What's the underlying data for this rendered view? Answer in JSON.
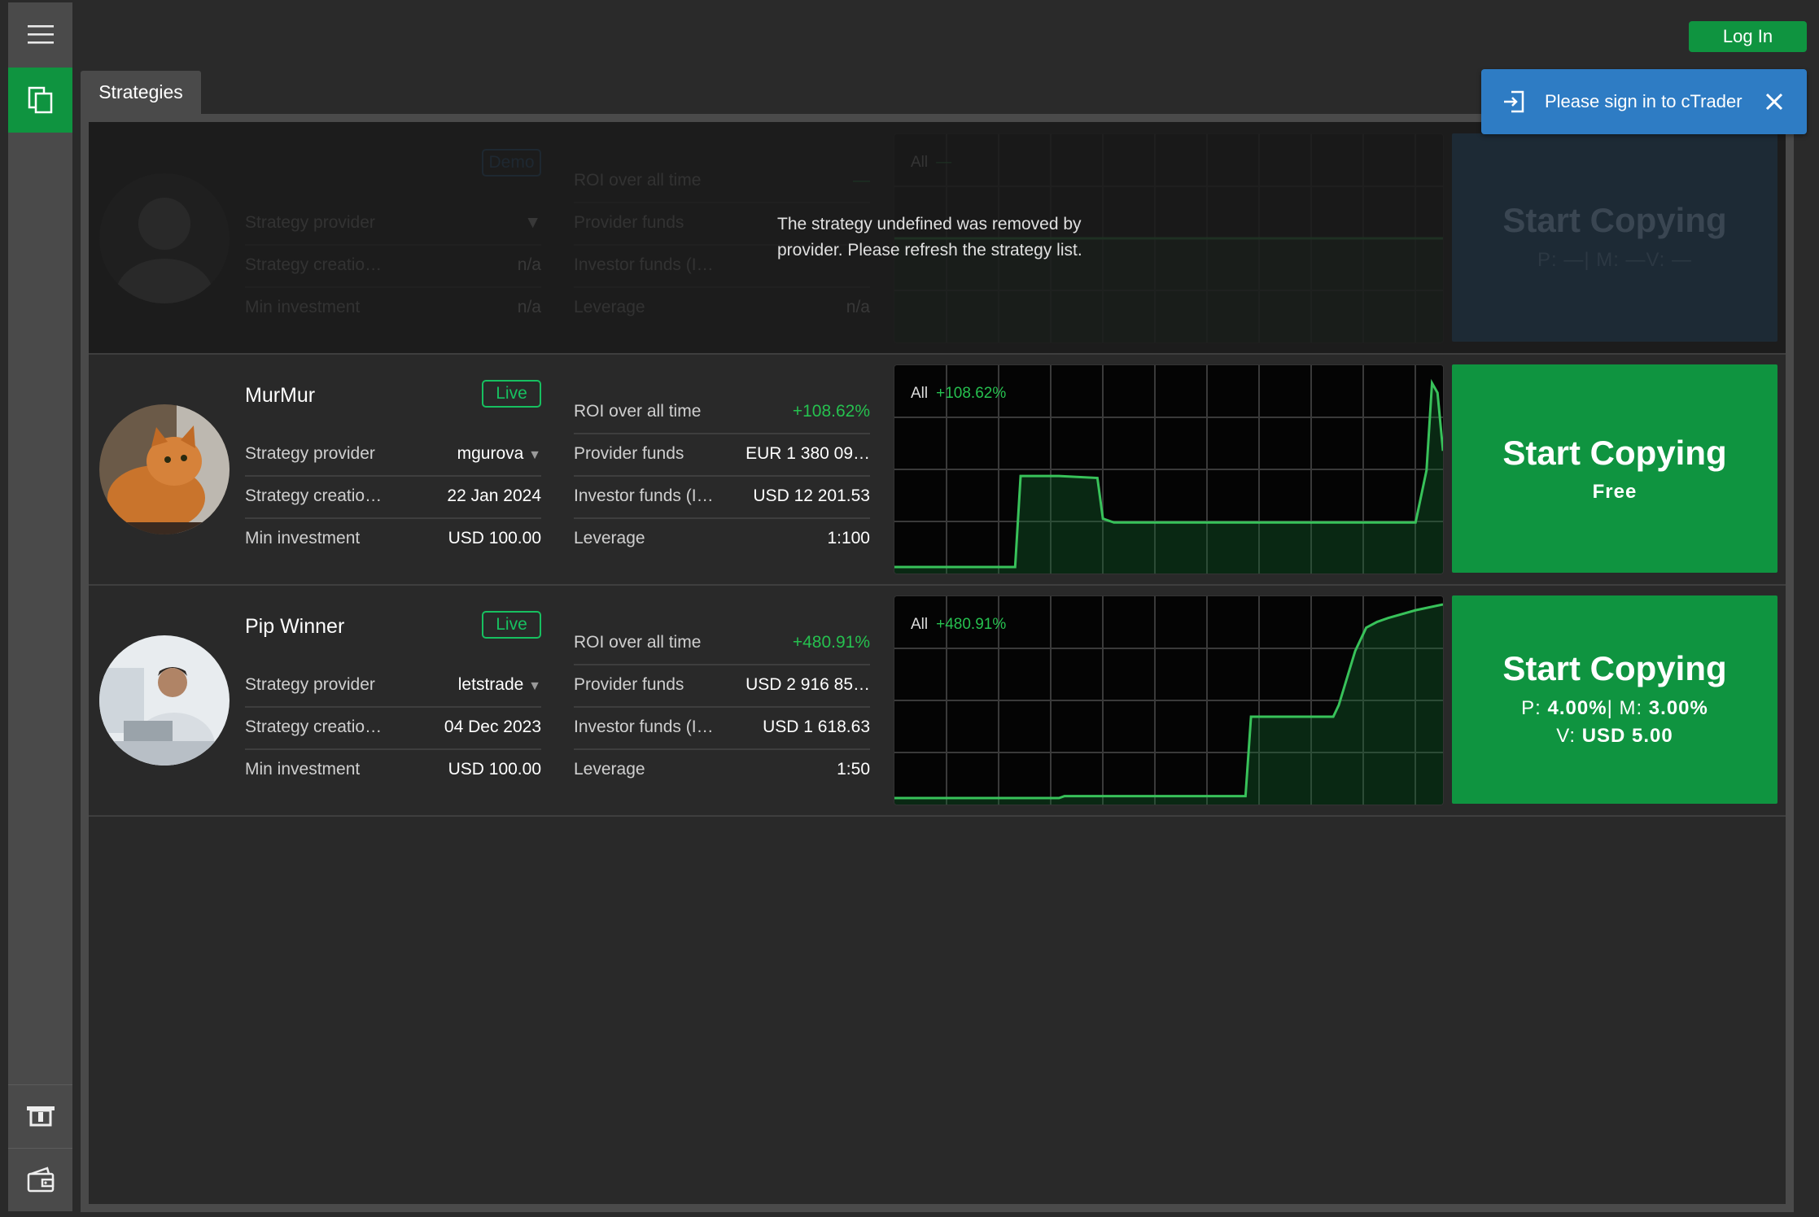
{
  "header": {
    "login_label": "Log In",
    "tab_label": "Strategies"
  },
  "toast": {
    "message": "Please sign in to cTrader",
    "icon": "sign-in-icon",
    "close_icon": "close-icon"
  },
  "sidebar": {
    "items": [
      {
        "icon": "hamburger-menu-icon"
      },
      {
        "icon": "copy-icon",
        "active": true
      },
      {
        "icon": "atm-icon"
      },
      {
        "icon": "wallet-icon"
      }
    ]
  },
  "colors": {
    "accent": "#0f9440",
    "positive": "#26c04f",
    "toast": "#2e7cc4"
  },
  "strategies": [
    {
      "removed": true,
      "name": "",
      "badge": "Demo",
      "provider_label": "Strategy provider",
      "provider": "",
      "creation_label": "Strategy creatio…",
      "creation": "n/a",
      "min_label": "Min investment",
      "min": "n/a",
      "roi_label": "ROI over all time",
      "roi": "—",
      "provider_funds_label": "Provider funds",
      "provider_funds": "",
      "investor_funds_label": "Investor funds (I…",
      "investor_funds": "",
      "leverage_label": "Leverage",
      "leverage": "n/a",
      "chart_range": "All",
      "chart_roi": "—",
      "copy_label": "Start Copying",
      "copy_sub": "P: —| M: —V: —",
      "message": "The strategy undefined was removed by provider. Please refresh the strategy list."
    },
    {
      "removed": false,
      "name": "MurMur",
      "badge": "Live",
      "provider_label": "Strategy provider",
      "provider": "mgurova",
      "creation_label": "Strategy creatio…",
      "creation": "22 Jan 2024",
      "min_label": "Min investment",
      "min": "USD 100.00",
      "roi_label": "ROI over all time",
      "roi": "+108.62%",
      "provider_funds_label": "Provider funds",
      "provider_funds": "EUR 1 380 09…",
      "investor_funds_label": "Investor funds (I…",
      "investor_funds": "USD 12 201.53",
      "leverage_label": "Leverage",
      "leverage": "1:100",
      "chart_range": "All",
      "chart_roi": "+108.62%",
      "copy_label": "Start Copying",
      "copy_fee": "Free"
    },
    {
      "removed": false,
      "name": "Pip Winner",
      "badge": "Live",
      "provider_label": "Strategy provider",
      "provider": "letstrade",
      "creation_label": "Strategy creatio…",
      "creation": "04 Dec 2023",
      "min_label": "Min investment",
      "min": "USD 100.00",
      "roi_label": "ROI over all time",
      "roi": "+480.91%",
      "provider_funds_label": "Provider funds",
      "provider_funds": "USD 2 916 85…",
      "investor_funds_label": "Investor funds (I…",
      "investor_funds": "USD 1 618.63",
      "leverage_label": "Leverage",
      "leverage": "1:50",
      "chart_range": "All",
      "chart_roi": "+480.91%",
      "copy_label": "Start Copying",
      "fee_p_label": "P:",
      "fee_p": "4.00%",
      "fee_m_label": "| M:",
      "fee_m": "3.00%",
      "fee_v_label": "V:",
      "fee_v": "USD 5.00"
    }
  ],
  "chart_data": [
    {
      "type": "area",
      "title": "",
      "series": [
        {
          "values": [
            0,
            0,
            0,
            0,
            0,
            0
          ]
        }
      ]
    },
    {
      "type": "area",
      "title": "",
      "x": [
        0,
        0.1,
        0.22,
        0.23,
        0.3,
        0.37,
        0.38,
        0.4,
        0.6,
        0.95,
        0.97,
        0.98,
        0.99,
        1.0
      ],
      "series": [
        {
          "values": [
            0,
            0,
            0,
            0.47,
            0.47,
            0.46,
            0.25,
            0.23,
            0.23,
            0.23,
            0.5,
            0.95,
            0.9,
            0.6
          ]
        }
      ]
    },
    {
      "type": "area",
      "title": "",
      "x": [
        0,
        0.3,
        0.31,
        0.64,
        0.65,
        0.8,
        0.81,
        0.84,
        0.86,
        0.88,
        0.9,
        0.95,
        1.0
      ],
      "series": [
        {
          "values": [
            0,
            0,
            0.01,
            0.01,
            0.42,
            0.42,
            0.48,
            0.76,
            0.88,
            0.91,
            0.93,
            0.97,
            1.0
          ]
        }
      ]
    }
  ]
}
